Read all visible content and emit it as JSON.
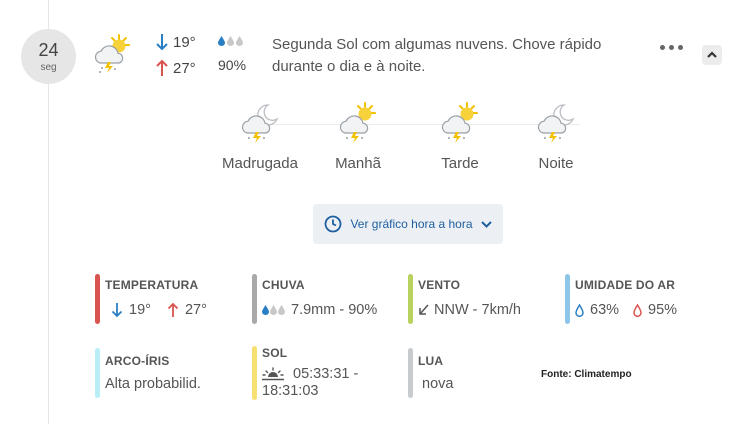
{
  "date": {
    "day": "24",
    "weekday": "seg"
  },
  "forecast": {
    "min_temp": "19°",
    "max_temp": "27°",
    "rain_probability": "90%",
    "summary": "Segunda Sol com algumas nuvens. Chove rápido durante o dia e à noite."
  },
  "periods": [
    {
      "label": "Madrugada",
      "icon": "cloud-moon-storm-icon"
    },
    {
      "label": "Manhã",
      "icon": "sun-cloud-storm-icon"
    },
    {
      "label": "Tarde",
      "icon": "sun-cloud-storm-icon"
    },
    {
      "label": "Noite",
      "icon": "cloud-moon-icon"
    }
  ],
  "hourly_button": {
    "label": "Ver gráfico hora a hora"
  },
  "stats": {
    "temperature": {
      "title": "TEMPERATURA",
      "min": "19°",
      "max": "27°",
      "color": "#d9534f"
    },
    "rain": {
      "title": "CHUVA",
      "value": "7.9mm - 90%",
      "color": "#a9a9a9"
    },
    "wind": {
      "title": "VENTO",
      "value": "NNW - 7km/h",
      "color": "#b9d25e"
    },
    "humidity": {
      "title": "UMIDADE DO AR",
      "min": "63%",
      "max": "95%",
      "color": "#8ec5ea"
    },
    "rainbow": {
      "title": "ARCO-ÍRIS",
      "value": "Alta probabilid.",
      "color": "#b8eef5"
    },
    "sun": {
      "title": "SOL",
      "value": "05:33:31 - 18:31:03",
      "value_line1": "05:33:31 -",
      "value_line2": "18:31:03",
      "color": "#f7df72"
    },
    "moon": {
      "title": "LUA",
      "value": "nova",
      "color": "#c7cbce"
    }
  },
  "source": "Fonte: Climatempo",
  "colors": {
    "arrow_down": "#2a7fc4",
    "arrow_up": "#d9534f",
    "link": "#1f5fa0"
  }
}
